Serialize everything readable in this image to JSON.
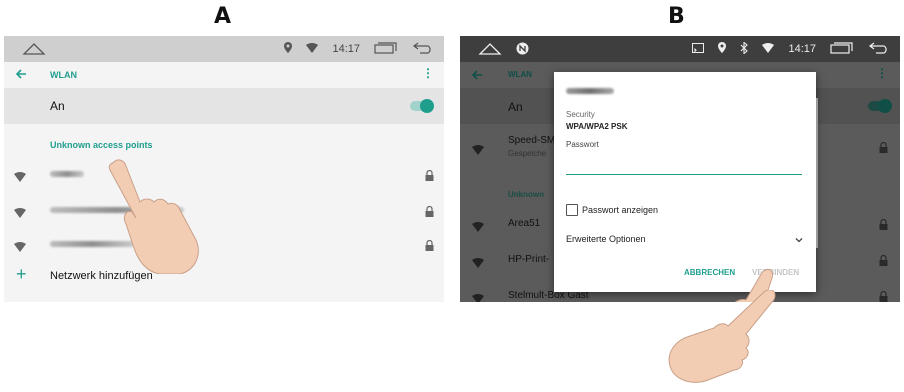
{
  "panels": {
    "a": {
      "letter": "A"
    },
    "b": {
      "letter": "B"
    }
  },
  "status_bar": {
    "time": "14:17",
    "icons": [
      "location-icon",
      "wifi-icon",
      "recents-icon",
      "back-icon"
    ]
  },
  "screen_a": {
    "toolbar_title": "WLAN",
    "switch_label": "An",
    "switch_on": true,
    "section_header": "Unknown access points",
    "add_network_label": "Netzwerk hinzufügen"
  },
  "screen_b": {
    "background": {
      "an": "An",
      "network_1": "Speed-SM",
      "network_1_status": "Gespeiche",
      "section_header_partial": "Unknown",
      "network_2": "Area51",
      "network_3": "HP-Print-",
      "network_4": "Stelmult-Box Gast"
    },
    "dialog": {
      "security_label": "Security",
      "security_value": "WPA/WPA2 PSK",
      "password_label": "Passwort",
      "password_value": "",
      "show_password_label": "Passwort anzeigen",
      "show_password_checked": false,
      "advanced_options_label": "Erweiterte Optionen",
      "cancel_label": "ABBRECHEN",
      "connect_label": "VERBINDEN"
    }
  },
  "colors": {
    "accent": "#1f9e8e",
    "disabled": "#c5c5c5"
  }
}
